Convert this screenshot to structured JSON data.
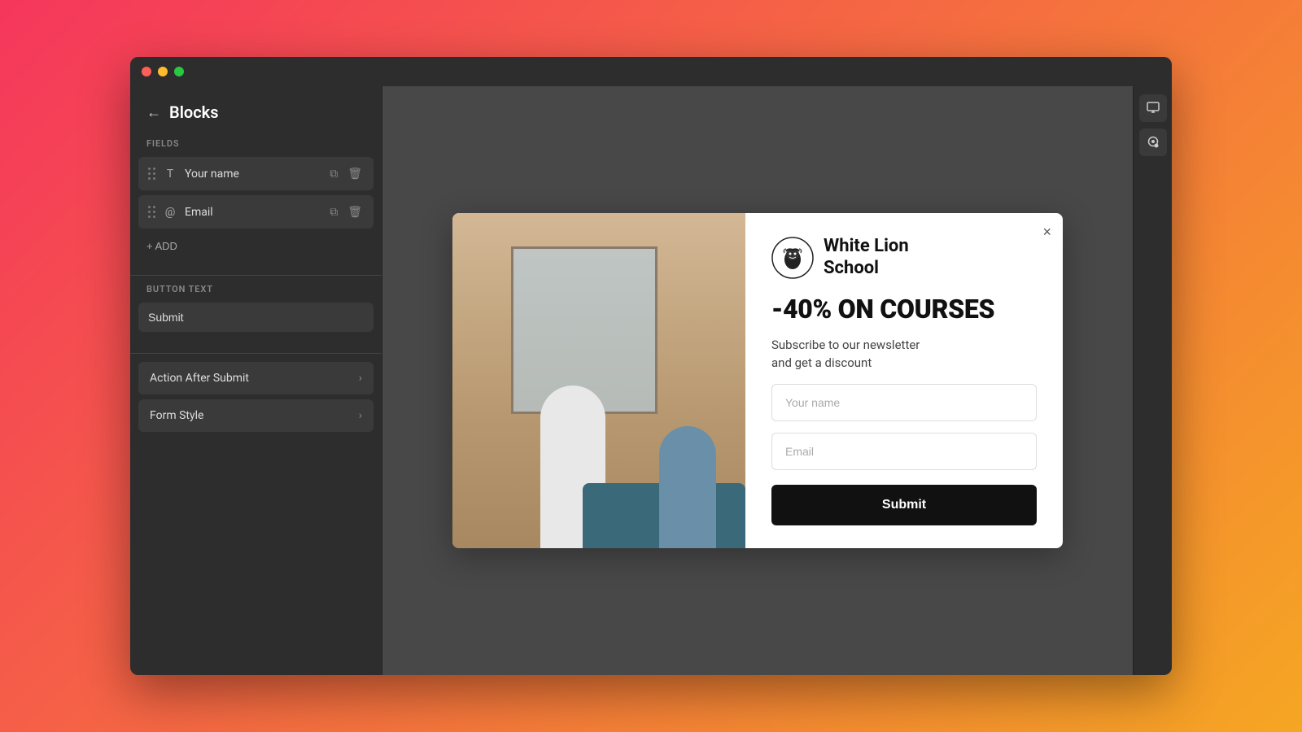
{
  "browser": {
    "dots": [
      "red",
      "yellow",
      "green"
    ]
  },
  "sidebar": {
    "title": "Blocks",
    "back_label": "←",
    "fields_section": "FIELDS",
    "fields": [
      {
        "id": "your-name",
        "icon": "T",
        "icon_type": "text",
        "label": "Your name"
      },
      {
        "id": "email",
        "icon": "@",
        "icon_type": "at",
        "label": "Email"
      }
    ],
    "add_label": "+ ADD",
    "button_text_section": "BUTTON TEXT",
    "button_text_value": "Submit",
    "button_text_placeholder": "Submit",
    "accordion_items": [
      {
        "id": "action-after-submit",
        "label": "Action After Submit"
      },
      {
        "id": "form-style",
        "label": "Form Style"
      }
    ]
  },
  "right_toolbar": {
    "buttons": [
      {
        "id": "monitor",
        "icon": "⬜"
      },
      {
        "id": "paint",
        "icon": "🎨"
      }
    ]
  },
  "popup": {
    "close_label": "×",
    "logo_alt": "White Lion School Lion Logo",
    "school_name": "White Lion\nSchool",
    "school_name_line1": "White Lion",
    "school_name_line2": "School",
    "discount_text": "-40% ON COURSES",
    "subtitle": "Subscribe to our newsletter\nand get a discount",
    "subtitle_line1": "Subscribe to our newsletter",
    "subtitle_line2": "and get a discount",
    "name_placeholder": "Your name",
    "email_placeholder": "Email",
    "submit_label": "Submit"
  }
}
